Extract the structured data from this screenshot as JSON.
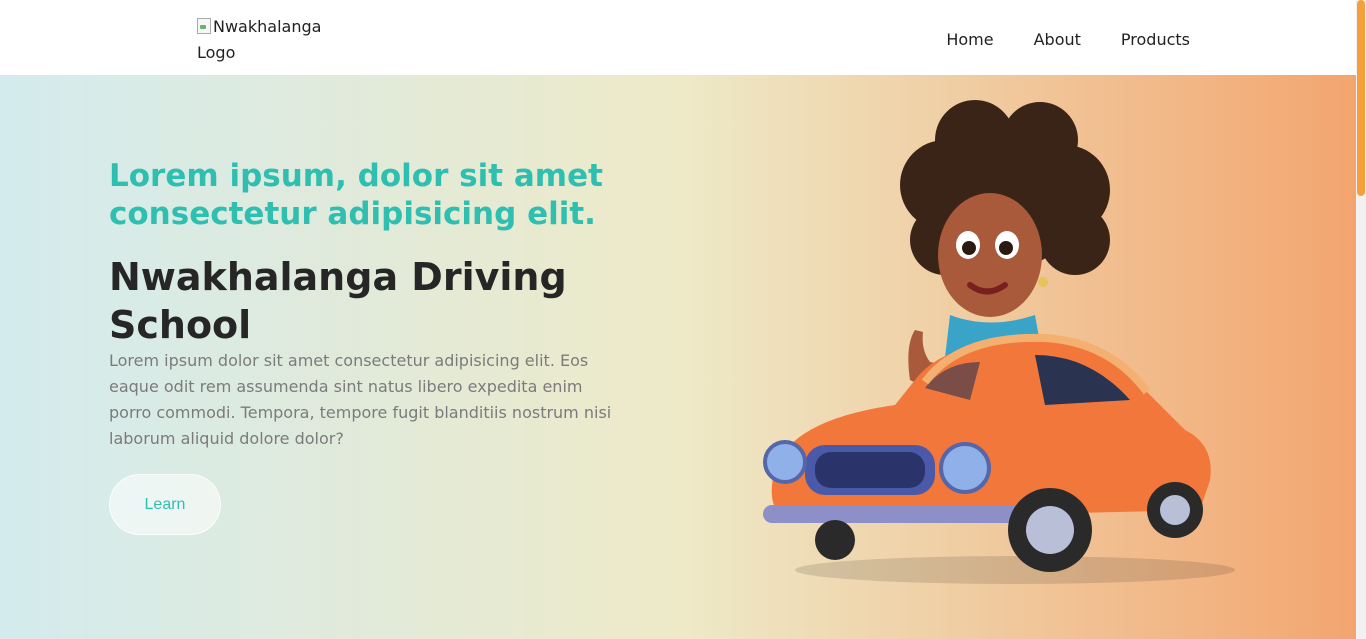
{
  "nav": {
    "logo_alt": "Nwakhalanga Logo",
    "links": [
      "Home",
      "About",
      "Products"
    ]
  },
  "hero": {
    "subtitle": "Lorem ipsum, dolor sit amet consectetur adipisicing elit.",
    "title": "Nwakhalanga Driving School",
    "description": "Lorem ipsum dolor sit amet consectetur adipisicing elit. Eos eaque odit rem assumenda sint natus libero expedita enim porro commodi. Tempora, tempore fugit blanditiis nostrum nisi laborum aliquid dolore dolor?",
    "button_label": "Learn",
    "image_icon": "girl-driving-orange-car-illustration"
  },
  "colors": {
    "accent": "#2fbfb0",
    "title": "#262626",
    "gradient_start": "#d3ebee",
    "gradient_mid": "#eeeac8",
    "gradient_end": "#f3a56f",
    "scroll_thumb": "#f5a03a"
  }
}
